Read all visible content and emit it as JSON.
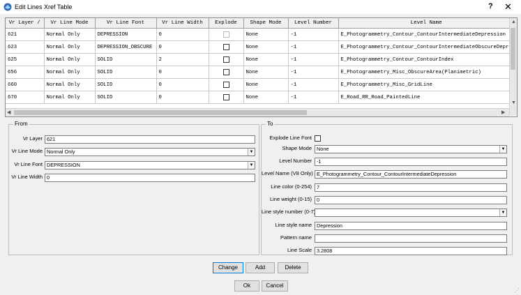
{
  "window": {
    "title": "Edit Lines Xref Table",
    "help_label": "?",
    "close_label": "✕"
  },
  "grid": {
    "columns": [
      "Vr Layer  /",
      "Vr Line Mode",
      "Vr Line Font",
      "Vr Line Width",
      "Explode",
      "Shape Mode",
      "Level Number",
      "Level Name"
    ],
    "rows": [
      {
        "layer": "621",
        "mode": "Normal Only",
        "font": "DEPRESSION",
        "width": "0",
        "explode": false,
        "shape": "None",
        "level": "-1",
        "name": "E_Photogrammetry_Contour_ContourIntermediateDepression"
      },
      {
        "layer": "623",
        "mode": "Normal Only",
        "font": "DEPRESSION_OBSCURE",
        "width": "0",
        "explode": false,
        "shape": "None",
        "level": "-1",
        "name": "E_Photogrammetry_Contour_ContourIntermediateObscureDepre"
      },
      {
        "layer": "625",
        "mode": "Normal Only",
        "font": "SOLID",
        "width": "2",
        "explode": false,
        "shape": "None",
        "level": "-1",
        "name": "E_Photogrammetry_Contour_ContourIndex"
      },
      {
        "layer": "656",
        "mode": "Normal Only",
        "font": "SOLID",
        "width": "0",
        "explode": false,
        "shape": "None",
        "level": "-1",
        "name": "E_Photogrammetry_Misc_ObscureArea(Planimetric)"
      },
      {
        "layer": "660",
        "mode": "Normal Only",
        "font": "SOLID",
        "width": "0",
        "explode": false,
        "shape": "None",
        "level": "-1",
        "name": "E_Photogrammetry_Misc_GridLine"
      },
      {
        "layer": "670",
        "mode": "Normal Only",
        "font": "SOLID",
        "width": "0",
        "explode": false,
        "shape": "None",
        "level": "-1",
        "name": "E_Road_RR_Road_PaintedLine"
      }
    ]
  },
  "from": {
    "legend": "From",
    "vr_layer_label": "Vr Layer",
    "vr_layer_value": "621",
    "vr_line_mode_label": "Vr Line Mode",
    "vr_line_mode_value": "Normal Only",
    "vr_line_font_label": "Vr Line Font",
    "vr_line_font_value": "DEPRESSION",
    "vr_line_width_label": "Vr Line Width",
    "vr_line_width_value": "0"
  },
  "to": {
    "legend": "To",
    "explode_label": "Explode Line Font",
    "shape_mode_label": "Shape Mode",
    "shape_mode_value": "None",
    "level_number_label": "Level Number",
    "level_number_value": "-1",
    "level_name_label": "Level Name (V8 Only)",
    "level_name_value": "E_Photogrammetry_Contour_ContourIntermediateDepression",
    "line_color_label": "Line color (0-254)",
    "line_color_value": "7",
    "line_weight_label": "Line weight (0-15)",
    "line_weight_value": "0",
    "line_style_number_label": "Line style number (0-7)",
    "line_style_number_value": "",
    "line_style_name_label": "Line style name",
    "line_style_name_value": "Depression",
    "pattern_name_label": "Pattern name",
    "pattern_name_value": "",
    "line_scale_label": "Line Scale",
    "line_scale_value": "3.2808"
  },
  "buttons": {
    "change": "Change",
    "add": "Add",
    "delete": "Delete",
    "ok": "Ok",
    "cancel": "Cancel"
  },
  "colors": {
    "accent": "#0078d7"
  }
}
